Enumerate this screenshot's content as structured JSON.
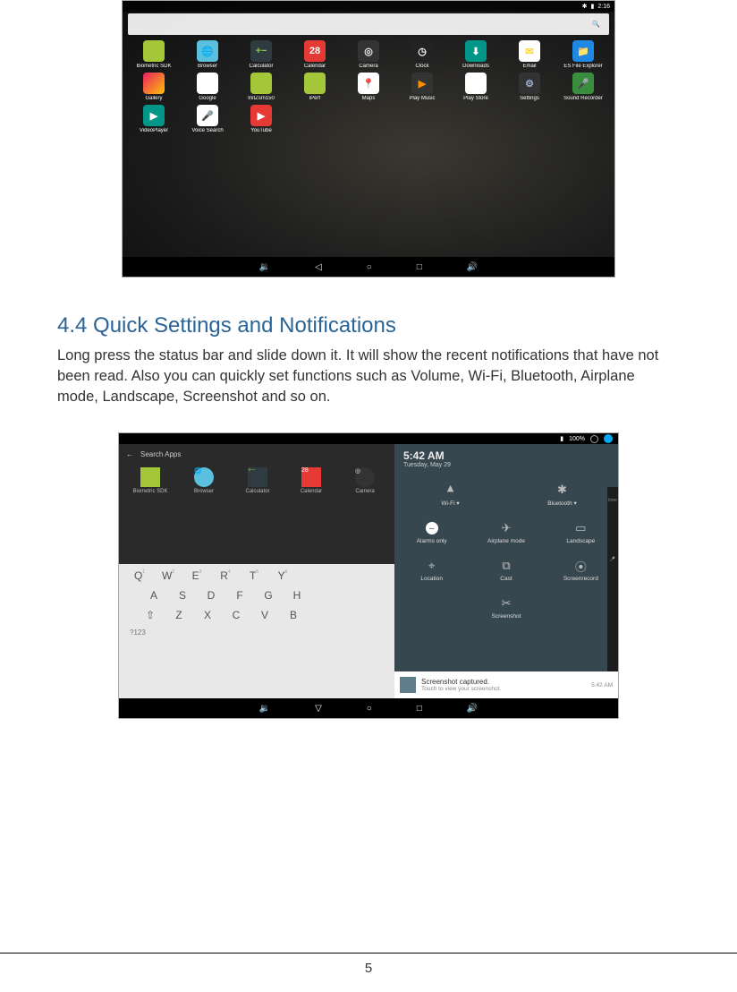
{
  "page_number": "5",
  "section_heading": "4.4 Quick Settings and Notifications",
  "section_body": "Long press the status bar and slide down it. It will show the recent notifications that have not been read. Also you can quickly set functions such as Volume, Wi-Fi, Bluetooth, Airplane mode, Landscape, Screenshot and so on.",
  "shot1": {
    "statusbar_time": "2:16",
    "apps_row1": [
      {
        "label": "Biometric SDK",
        "glyph": "",
        "cls": "ic-green"
      },
      {
        "label": "Browser",
        "glyph": "🌐",
        "cls": "ic-globe"
      },
      {
        "label": "Calculator",
        "glyph": "+−",
        "cls": "ic-dark"
      },
      {
        "label": "Calendar",
        "glyph": "28",
        "cls": "ic-red"
      },
      {
        "label": "Camera",
        "glyph": "◎",
        "cls": "ic-cam"
      },
      {
        "label": "Clock",
        "glyph": "◷",
        "cls": "ic-clock"
      },
      {
        "label": "Downloads",
        "glyph": "⬇",
        "cls": "ic-dl"
      },
      {
        "label": "Email",
        "glyph": "✉",
        "cls": "ic-mail"
      },
      {
        "label": "ES File Explorer",
        "glyph": "📁",
        "cls": "ic-esf"
      }
    ],
    "apps_row2": [
      {
        "label": "Gallery",
        "glyph": "",
        "cls": "ic-gal"
      },
      {
        "label": "Google",
        "glyph": "G",
        "cls": "ic-goog"
      },
      {
        "label": "InitZsm150",
        "glyph": "",
        "cls": "ic-green"
      },
      {
        "label": "iPerf",
        "glyph": "",
        "cls": "ic-green"
      },
      {
        "label": "Maps",
        "glyph": "📍",
        "cls": "ic-maps"
      },
      {
        "label": "Play Music",
        "glyph": "▶",
        "cls": "ic-pm"
      },
      {
        "label": "Play Store",
        "glyph": "▶",
        "cls": "ic-ps"
      },
      {
        "label": "Settings",
        "glyph": "⚙",
        "cls": "ic-set"
      },
      {
        "label": "Sound Recorder",
        "glyph": "🎤",
        "cls": "ic-sr"
      }
    ],
    "apps_row3": [
      {
        "label": "VideoPlayer",
        "glyph": "▶",
        "cls": "ic-vp"
      },
      {
        "label": "Voice Search",
        "glyph": "🎤",
        "cls": "ic-vs"
      },
      {
        "label": "YouTube",
        "glyph": "▶",
        "cls": "ic-yt"
      }
    ]
  },
  "shot2": {
    "battery_pct": "100%",
    "left_search": "Search Apps",
    "left_apps": [
      {
        "label": "Biometric SDK",
        "glyph": "",
        "cls": "ic-green"
      },
      {
        "label": "Browser",
        "glyph": "🌐",
        "cls": "ic-globe"
      },
      {
        "label": "Calculator",
        "glyph": "+−",
        "cls": "ic-dark"
      },
      {
        "label": "Calendar",
        "glyph": "28",
        "cls": "ic-red"
      },
      {
        "label": "Camera",
        "glyph": "◎",
        "cls": "ic-cam"
      }
    ],
    "timebox": {
      "time": "5:42 AM",
      "date": "Tuesday, May 29"
    },
    "tiles_row1": [
      {
        "label": "Wi-Fi ▾",
        "icon": "wifi",
        "glyph": "▾"
      },
      {
        "label": "Bluetooth ▾",
        "icon": "bluetooth",
        "glyph": "✱"
      }
    ],
    "tiles_row2": [
      {
        "label": "Alarms only",
        "icon": "dnd",
        "glyph": "–"
      },
      {
        "label": "Airplane mode",
        "icon": "airplane",
        "glyph": "✈"
      },
      {
        "label": "Landscape",
        "icon": "landscape",
        "glyph": "▭"
      }
    ],
    "tiles_row3": [
      {
        "label": "Location",
        "icon": "location",
        "glyph": "⌖"
      },
      {
        "label": "Cast",
        "icon": "cast",
        "glyph": "⧉"
      },
      {
        "label": "Screenrecord",
        "icon": "screenrecord",
        "glyph": "⦿"
      }
    ],
    "tiles_row4": [
      {
        "label": "Screenshot",
        "icon": "screenshot",
        "glyph": "✂"
      }
    ],
    "notification": {
      "title": "Screenshot captured.",
      "sub": "Touch to view your screenshot.",
      "time": "5:42 AM"
    },
    "keyboard": {
      "row1": [
        "Q",
        "W",
        "E",
        "R",
        "T",
        "Y"
      ],
      "row2": [
        "A",
        "S",
        "D",
        "F",
        "G",
        "H"
      ],
      "row3": [
        "Z",
        "X",
        "C",
        "V",
        "B"
      ],
      "sym": "?123"
    },
    "rightstrip": [
      "lorer"
    ]
  },
  "nav_icons": {
    "vol_down": "🔉",
    "back": "◁",
    "home": "○",
    "recent": "□",
    "vol_up": "🔊",
    "back_down": "▽"
  }
}
